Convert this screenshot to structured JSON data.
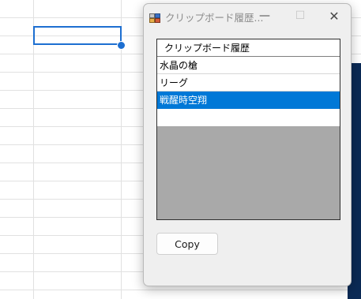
{
  "window": {
    "title": "クリップボード履歴...",
    "minimize": "—",
    "maximize": "☐",
    "close": "✕"
  },
  "list": {
    "items": [
      {
        "label": "クリップボード履歴",
        "kind": "header"
      },
      {
        "label": "水晶の槍",
        "kind": "item"
      },
      {
        "label": "リーグ",
        "kind": "item"
      },
      {
        "label": "戦醒時空翔",
        "kind": "selected"
      }
    ]
  },
  "buttons": {
    "copy_label": "Copy"
  },
  "colors": {
    "selection": "#0078d7",
    "list_background": "#a9a9a9",
    "cell_selection": "#1d6fd1"
  }
}
